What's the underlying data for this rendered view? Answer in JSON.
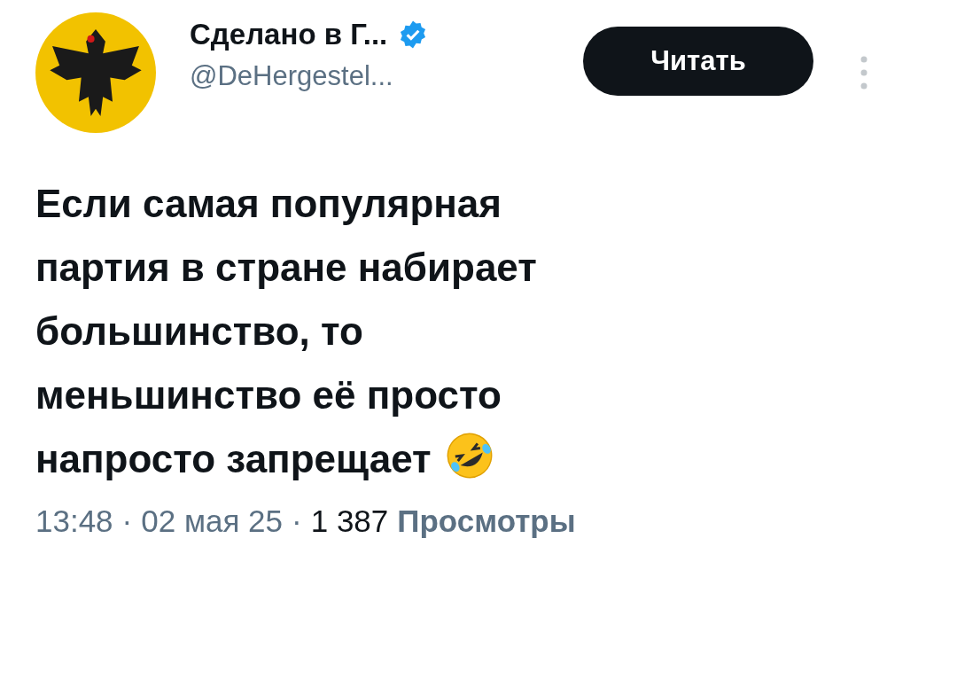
{
  "author": {
    "name": "Сделано в Г...",
    "verified": true,
    "handle": "@DeHergestel..."
  },
  "follow_button": {
    "label": "Читать"
  },
  "tweet": {
    "text": "Если самая популярная\nпартия в стране набирает\nбольшинство, то\nменьшинство её просто\nнапросто запрещает",
    "emoji": true
  },
  "meta": [
    {
      "text": "13:48",
      "kind": "muted"
    },
    {
      "text": "·",
      "kind": "muted"
    },
    {
      "text": "02 мая 25",
      "kind": "muted"
    },
    {
      "text": "·",
      "kind": "muted"
    },
    {
      "text": "1 387",
      "kind": "strong"
    },
    {
      "text": "Просмотры",
      "kind": "label"
    }
  ]
}
